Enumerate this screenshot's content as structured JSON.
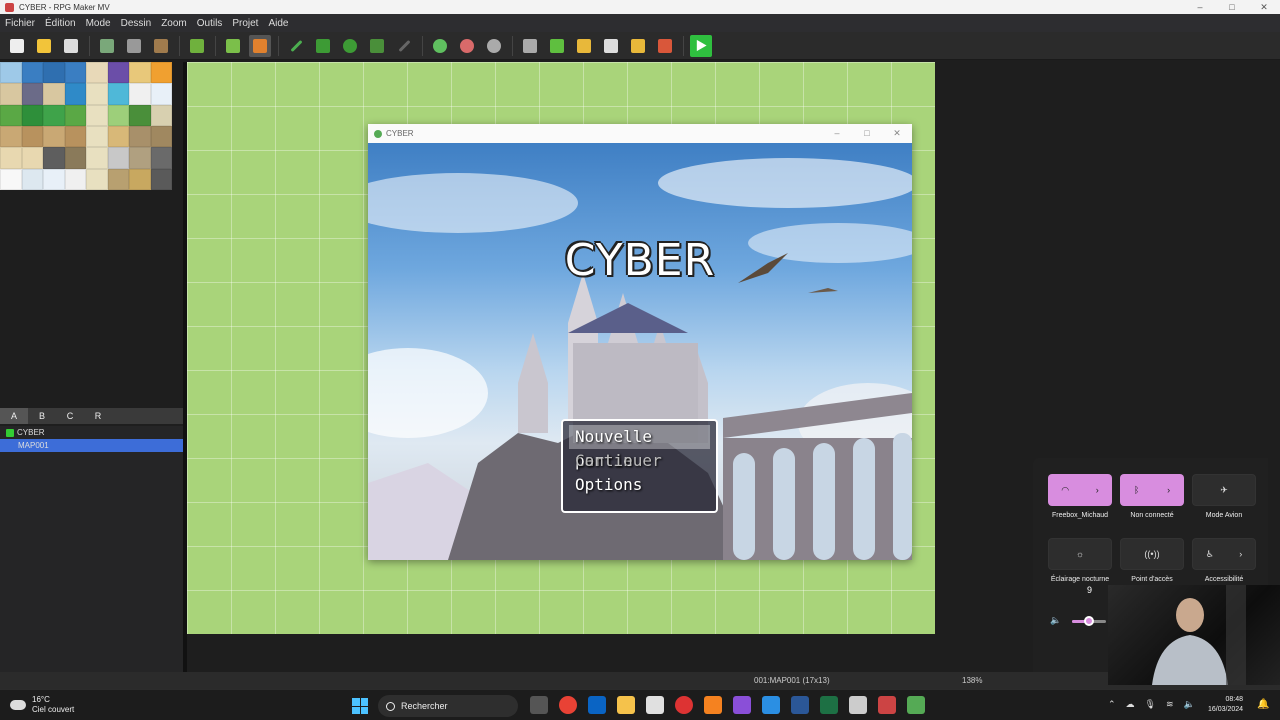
{
  "window": {
    "title": "CYBER - RPG Maker MV",
    "controls": [
      "–",
      "□",
      "✕"
    ]
  },
  "menu": [
    "Fichier",
    "Édition",
    "Mode",
    "Dessin",
    "Zoom",
    "Outils",
    "Projet",
    "Aide"
  ],
  "toolbar": {
    "groups": [
      [
        "new-project-icon",
        "open-project-icon",
        "save-project-icon"
      ],
      [
        "cut-icon",
        "copy-icon",
        "paste-icon"
      ],
      [
        "undo-icon"
      ],
      [
        "map-mode-icon",
        "event-mode-icon"
      ],
      [
        "pencil-icon",
        "rectangle-icon",
        "ellipse-icon",
        "fill-icon",
        "shadow-pen-icon"
      ],
      [
        "zoom-in-icon",
        "zoom-out-icon",
        "actual-size-icon"
      ],
      [
        "database-icon",
        "plugin-manager-icon",
        "sound-test-icon",
        "event-searcher-icon",
        "resource-manager-icon",
        "character-generator-icon"
      ],
      [
        "playtest-icon"
      ]
    ],
    "colors": {
      "new-project-icon": "#eeeeee",
      "open-project-icon": "#f2c43a",
      "save-project-icon": "#dddddd",
      "cut-icon": "#7aa87a",
      "copy-icon": "#999999",
      "paste-icon": "#a07b4d",
      "undo-icon": "#6fb13d",
      "map-mode-icon": "#7bbf4a",
      "event-mode-icon": "#e0812e",
      "pencil-icon": "#4caf50",
      "rectangle-icon": "#3d9b35",
      "ellipse-icon": "#3d9b35",
      "fill-icon": "#4a8f3a",
      "shadow-pen-icon": "#666666",
      "zoom-in-icon": "#5fbf5f",
      "zoom-out-icon": "#d96a6a",
      "actual-size-icon": "#aaaaaa",
      "database-icon": "#aaaaaa",
      "plugin-manager-icon": "#5fbf3f",
      "sound-test-icon": "#e8b83a",
      "event-searcher-icon": "#dddddd",
      "resource-manager-icon": "#e8b83a",
      "character-generator-icon": "#d9573a",
      "playtest-icon": "#2fbf3f"
    }
  },
  "tileset_tabs": [
    "A",
    "B",
    "C",
    "R"
  ],
  "map_tree": {
    "project": "CYBER",
    "maps": [
      "MAP001"
    ]
  },
  "game_window": {
    "title": "CYBER",
    "game_title": "CYBER",
    "menu": [
      {
        "label": "Nouvelle partie",
        "selected": true,
        "enabled": true
      },
      {
        "label": "Continuer",
        "selected": false,
        "enabled": false
      },
      {
        "label": "Options",
        "selected": false,
        "enabled": true
      }
    ]
  },
  "status_bar": {
    "map_info": "001:MAP001 (17x13)",
    "zoom": "138%"
  },
  "quick_settings": {
    "tiles": [
      {
        "label": "Freebox_Michaud",
        "icon": "wifi-icon",
        "active": true,
        "has_arrow": true
      },
      {
        "label": "Non connecté",
        "icon": "bluetooth-icon",
        "active": true,
        "has_arrow": true
      },
      {
        "label": "Mode Avion",
        "icon": "airplane-icon",
        "active": false,
        "has_arrow": false
      },
      {
        "label": "Éclairage nocturne",
        "icon": "brightness-icon",
        "active": false,
        "has_arrow": false
      },
      {
        "label": "Point d'accès",
        "icon": "hotspot-icon",
        "active": false,
        "has_arrow": false
      },
      {
        "label": "Accessibilité",
        "icon": "accessibility-icon",
        "active": false,
        "has_arrow": true
      }
    ],
    "volume_tooltip": "9",
    "volume_level": 0.5
  },
  "taskbar": {
    "weather_temp": "16°C",
    "weather_desc": "Ciel couvert",
    "search_placeholder": "Rechercher",
    "time": "08:48",
    "date": "16/03/2024"
  }
}
